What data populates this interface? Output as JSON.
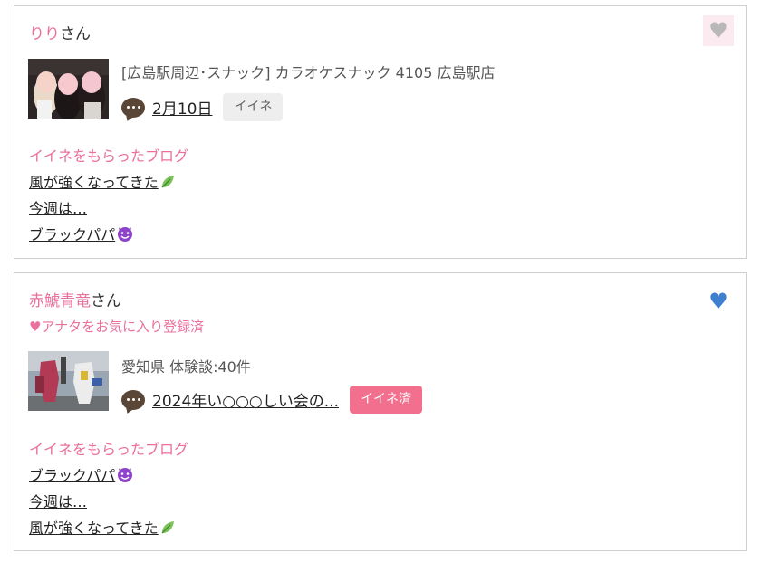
{
  "cards": [
    {
      "user_name": "りり",
      "san": "さん",
      "heart": "♥",
      "info": "[広島駅周辺･スナック]  カラオケスナック 4105 広島駅店",
      "comment_link": "2月10日",
      "iine_label": "イイネ",
      "blog_heading": "イイネをもらったブログ",
      "blogs": [
        "風が強くなってきた",
        "今週は…",
        "ブラックパパ"
      ]
    },
    {
      "user_name": "赤鯱青竜",
      "san": "さん",
      "heart": "♥",
      "favorite_note": "♥アナタをお気に入り登録済",
      "info": "愛知県  体験談:40件",
      "comment_link": "2024年い○○○しい会の...",
      "iine_label": "イイネ済",
      "blog_heading": "イイネをもらったブログ",
      "blogs": [
        "ブラックパパ",
        "今週は…",
        "風が強くなってきた"
      ]
    }
  ],
  "colors": {
    "accent_pink": "#ea6f9c",
    "button_pink": "#f26f8d",
    "heart_blue": "#3f7fd0",
    "heart_gray": "#b8b8b8"
  },
  "icons": [
    "comment-bubble-icon",
    "heart-icon",
    "leaf-icon",
    "devil-icon"
  ]
}
